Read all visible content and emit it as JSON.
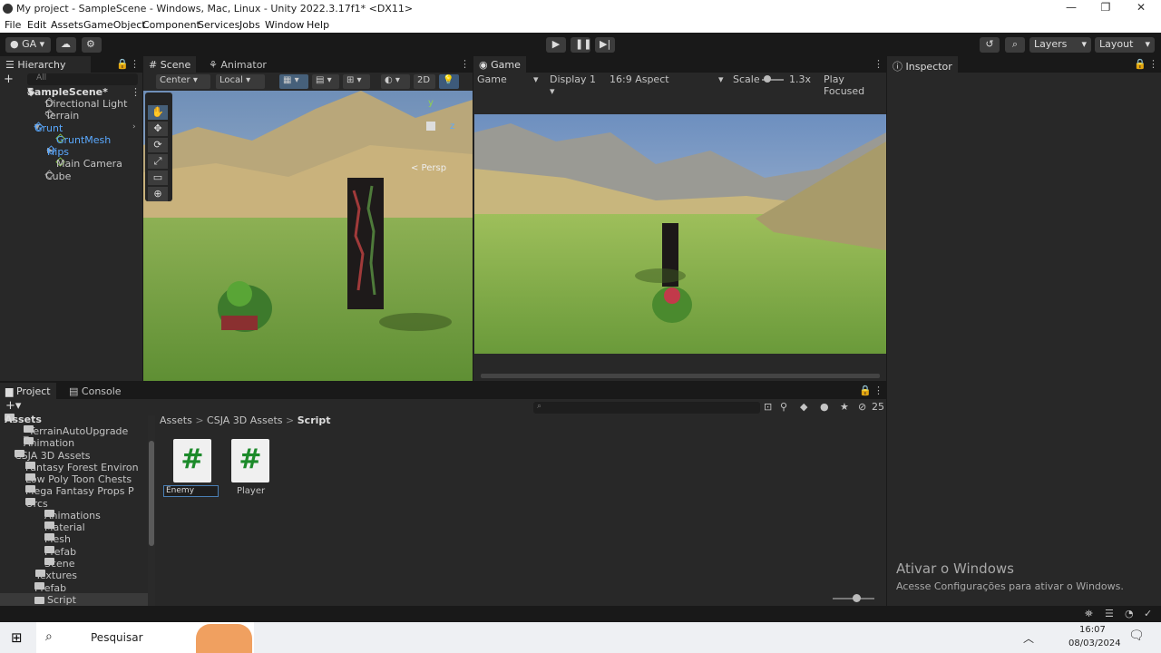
{
  "window": {
    "title": "My project - SampleScene - Windows, Mac, Linux - Unity 2022.3.17f1* <DX11>",
    "minimize": "—",
    "maximize": "❐",
    "close": "✕"
  },
  "menu": [
    "File",
    "Edit",
    "Assets",
    "GameObject",
    "Component",
    "Services",
    "Jobs",
    "Window",
    "Help"
  ],
  "toolbar": {
    "account": "GA",
    "layers": "Layers",
    "layout": "Layout"
  },
  "hierarchy": {
    "tab": "Hierarchy",
    "search_placeholder": "All",
    "scene": "SampleScene*",
    "items": [
      {
        "label": "Directional Light",
        "color": "#c4c4c4"
      },
      {
        "label": "Terrain",
        "color": "#c4c4c4"
      },
      {
        "label": "Grunt",
        "color": "#5aa9ff"
      },
      {
        "label": "GruntMesh",
        "color": "#5aa9ff"
      },
      {
        "label": "Hips",
        "color": "#5aa9ff"
      },
      {
        "label": "Main Camera",
        "color": "#c4c4c4"
      },
      {
        "label": "Cube",
        "color": "#c4c4c4"
      }
    ]
  },
  "scene_view": {
    "tab_scene": "Scene",
    "tab_animator": "Animator",
    "pivot": "Center",
    "space": "Local",
    "mode_2d": "2D",
    "persp": "< Persp",
    "gizmo_y": "y",
    "gizmo_z": "z"
  },
  "game_view": {
    "tab": "Game",
    "view_select": "Game",
    "display": "Display 1",
    "aspect": "16:9 Aspect",
    "scale_label": "Scale",
    "scale_value": "1.3x",
    "play_focused": "Play Focused"
  },
  "inspector": {
    "tab": "Inspector"
  },
  "project": {
    "tab_project": "Project",
    "tab_console": "Console",
    "hidden_count": "25",
    "breadcrumb": [
      "Assets",
      "CSJA 3D Assets",
      "Script"
    ],
    "tree": [
      {
        "label": "Assets",
        "bold": true
      },
      {
        "label": "_TerrainAutoUpgrade"
      },
      {
        "label": "Animation"
      },
      {
        "label": "CSJA 3D Assets"
      },
      {
        "label": "Fantasy Forest Environ"
      },
      {
        "label": "Low Poly Toon Chests"
      },
      {
        "label": "Mega Fantasy Props P"
      },
      {
        "label": "Orcs"
      },
      {
        "label": "Animations"
      },
      {
        "label": "Material"
      },
      {
        "label": "Mesh"
      },
      {
        "label": "Prefab"
      },
      {
        "label": "Scene"
      },
      {
        "label": "Textures"
      },
      {
        "label": "Prefab"
      },
      {
        "label": "Script"
      }
    ],
    "assets": [
      {
        "label": "Enemy",
        "glyph": "#"
      },
      {
        "label": "Player",
        "glyph": "#"
      }
    ]
  },
  "watermark": {
    "title": "Ativar o Windows",
    "subtitle": "Acesse Configurações para ativar o Windows."
  },
  "taskbar": {
    "search": "Pesquisar",
    "time": "16:07",
    "date": "08/03/2024"
  }
}
